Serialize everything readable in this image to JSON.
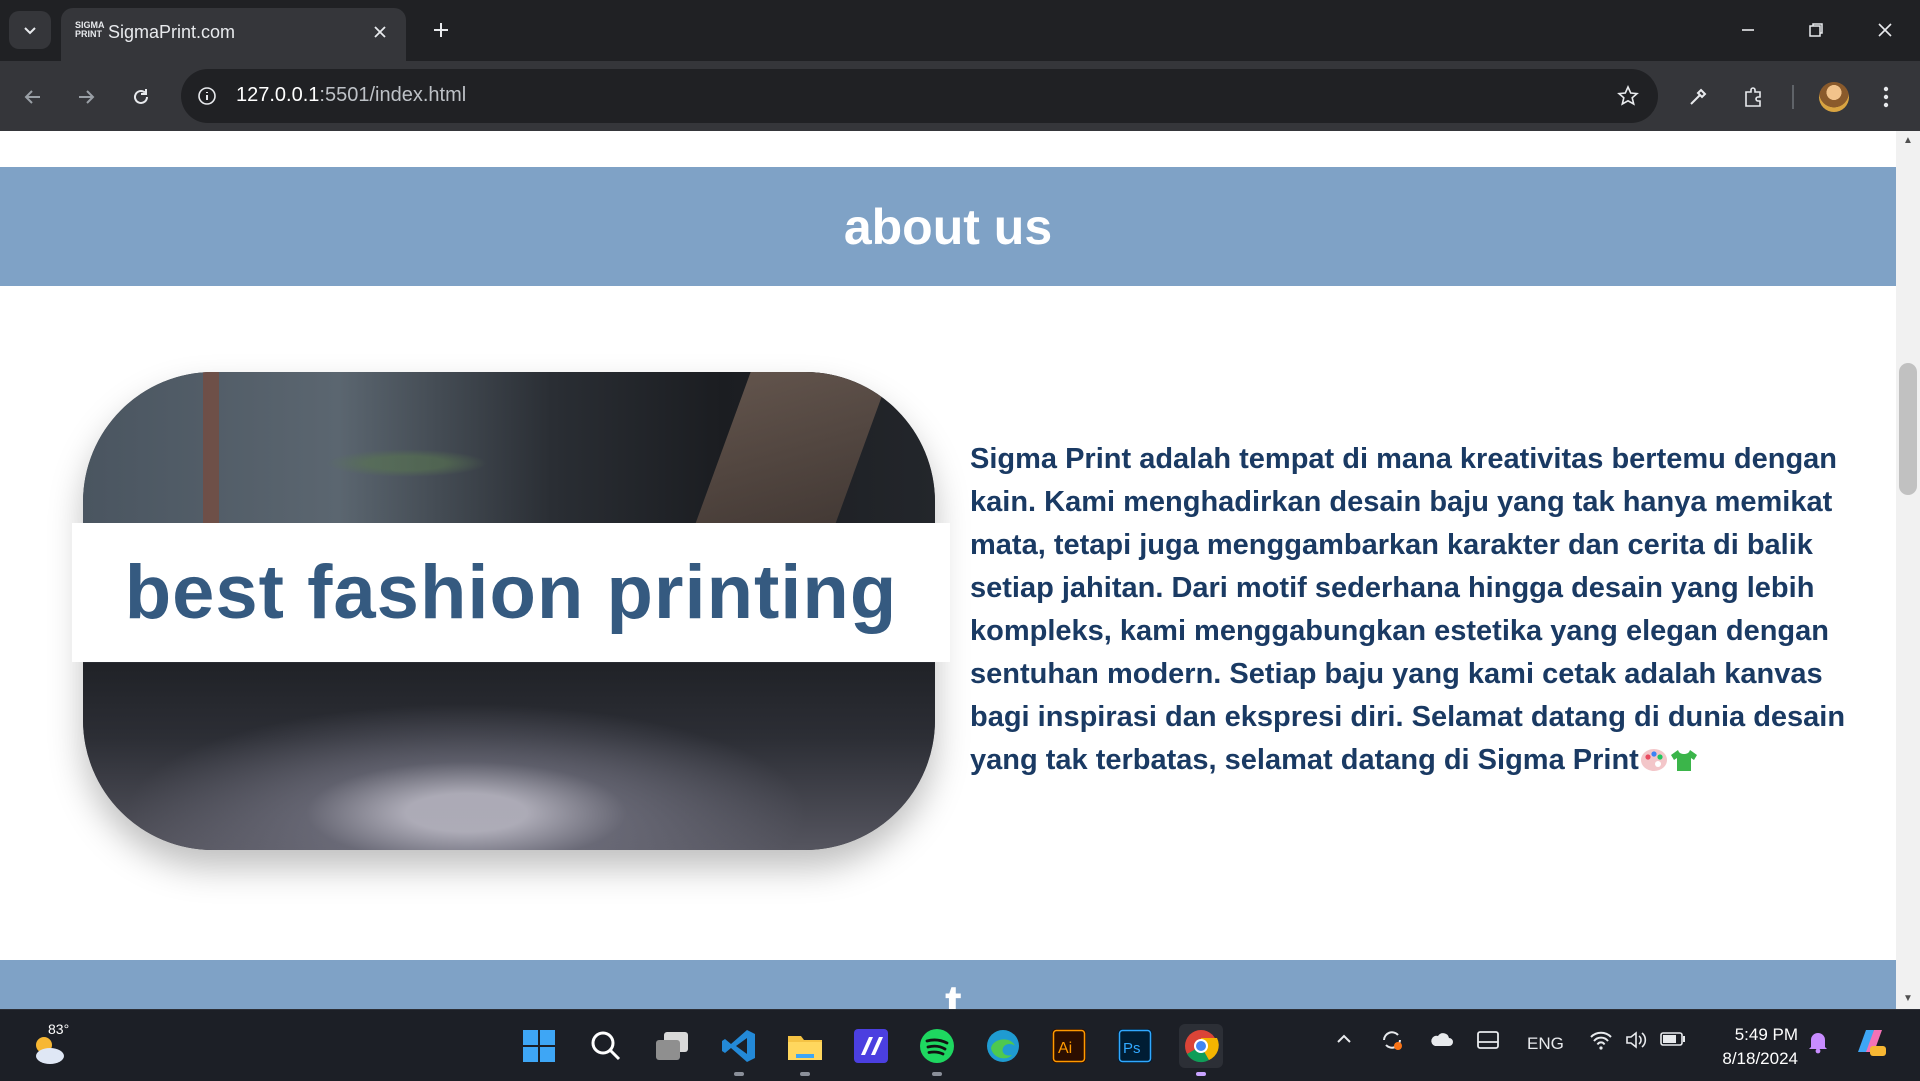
{
  "browser": {
    "tab": {
      "favicon_text": "SIGMA PRINT",
      "title": "SigmaPrint.com"
    },
    "address_bar": {
      "host": "127.0.0.1",
      "rest": ":5501/index.html"
    }
  },
  "page": {
    "about_section": {
      "heading": "about us",
      "banner_text": "best fashion printing",
      "paragraph": "Sigma Print adalah tempat di mana kreativitas bertemu dengan kain. Kami menghadirkan desain baju yang tak hanya memikat mata, tetapi juga menggambarkan karakter dan cerita di balik setiap jahitan. Dari motif sederhana hingga desain yang lebih kompleks, kami menggabungkan estetika yang elegan dengan sentuhan modern. Setiap baju yang kami cetak adalah kanvas bagi inspirasi dan ekspresi diri. Selamat datang di dunia desain yang tak terbatas, selamat datang di Sigma Print",
      "emojis": [
        "palette-icon",
        "tshirt-icon"
      ]
    },
    "next_section_peek": "t"
  },
  "taskbar": {
    "weather_temp": "83°",
    "language": "ENG",
    "time": "5:49 PM",
    "date": "8/18/2024"
  },
  "colors": {
    "section_band": "#7fa2c6",
    "banner_text": "#355a80",
    "paragraph_text": "#1a3a63",
    "chrome_dark": "#202124",
    "chrome_mid": "#35363a"
  }
}
